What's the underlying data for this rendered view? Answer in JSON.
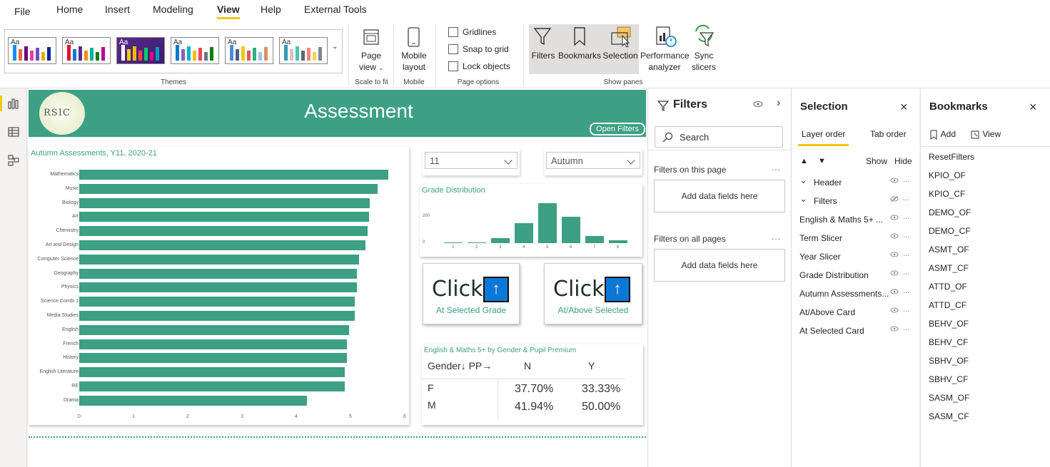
{
  "menu": {
    "items": [
      "File",
      "Home",
      "Insert",
      "Modeling",
      "View",
      "Help",
      "External Tools"
    ],
    "active": "View"
  },
  "ribbon": {
    "themes_label": "Themes",
    "theme_prefix": "Aa",
    "scale_to_fit": {
      "label_line1": "Page",
      "label_line2": "view",
      "group": "Scale to fit"
    },
    "mobile": {
      "label_line1": "Mobile",
      "label_line2": "layout",
      "group": "Mobile"
    },
    "page_options": {
      "gridlines": "Gridlines",
      "snap": "Snap to grid",
      "lock": "Lock objects",
      "group": "Page options"
    },
    "show_panes": {
      "filters": "Filters",
      "bookmarks": "Bookmarks",
      "selection": "Selection",
      "perf_line1": "Performance",
      "perf_line2": "analyzer",
      "sync_line1": "Sync",
      "sync_line2": "slicers",
      "group": "Show panes"
    }
  },
  "report": {
    "title": "Assessment",
    "logo_text": "RSIC",
    "open_filters": "Open Filters",
    "year_slicer": "11",
    "term_slicer": "Autumn",
    "click_label": "Click",
    "arrow_glyph": "↑",
    "card1_sub": "At Selected Grade",
    "card2_sub": "At/Above Selected",
    "matrix": {
      "title": "English & Maths 5+ by Gender & Pupil Premium",
      "header": "Gender↓ PP→",
      "cols": [
        "N",
        "Y"
      ],
      "rows": [
        {
          "label": "F",
          "N": "37.70%",
          "Y": "33.33%"
        },
        {
          "label": "M",
          "N": "41.94%",
          "Y": "50.00%"
        }
      ]
    }
  },
  "chart_data": [
    {
      "type": "bar",
      "orientation": "horizontal",
      "title": "Autumn Assessments, Y11, 2020-21",
      "categories": [
        "Mathematics",
        "Music",
        "Biology",
        "Art",
        "Chemistry",
        "Art and Design",
        "Computer Science",
        "Geography",
        "Physics",
        "Science Combi 1",
        "Media Studies",
        "English",
        "French",
        "History",
        "English Literature",
        "RE",
        "Drama"
      ],
      "values": [
        5.7,
        5.5,
        5.35,
        5.34,
        5.32,
        5.28,
        5.16,
        5.12,
        5.12,
        5.08,
        5.08,
        4.97,
        4.93,
        4.93,
        4.9,
        4.89,
        4.2
      ],
      "xlim": [
        0,
        6
      ],
      "xticks": [
        "0",
        "1",
        "2",
        "3",
        "4",
        "5",
        "6"
      ]
    },
    {
      "type": "bar",
      "title": "Grade Distribution",
      "categories": [
        "1",
        "2",
        "3",
        "4",
        "5",
        "6",
        "7",
        "8"
      ],
      "values": [
        3,
        4,
        40,
        150,
        300,
        195,
        55,
        20
      ],
      "ylim": [
        0,
        320
      ],
      "yticks": [
        "0",
        "200"
      ]
    }
  ],
  "filters_pane": {
    "title": "Filters",
    "search_placeholder": "Search",
    "on_this_page": "Filters on this page",
    "on_all_pages": "Filters on all pages",
    "add_fields": "Add data fields here",
    "dots": "..."
  },
  "selection_pane": {
    "title": "Selection",
    "tab_layer": "Layer order",
    "tab_tab": "Tab order",
    "show": "Show",
    "hide": "Hide",
    "items": [
      {
        "label": "Header",
        "group": true
      },
      {
        "label": "Filters",
        "group": true
      },
      {
        "label": "English & Maths 5+ ...",
        "group": false
      },
      {
        "label": "Term Slicer",
        "group": false
      },
      {
        "label": "Year Slicer",
        "group": false
      },
      {
        "label": "Grade Distribution",
        "group": false
      },
      {
        "label": "Autumn Assessments...",
        "group": false
      },
      {
        "label": "At/Above Card",
        "group": false
      },
      {
        "label": "At Selected Card",
        "group": false
      }
    ]
  },
  "bookmarks_pane": {
    "title": "Bookmarks",
    "add": "Add",
    "view": "View",
    "items": [
      "ResetFilters",
      "KPIO_OF",
      "KPIO_CF",
      "DEMO_OF",
      "DEMO_CF",
      "ASMT_OF",
      "ASMT_CF",
      "ATTD_OF",
      "ATTD_CF",
      "BEHV_OF",
      "BEHV_CF",
      "SBHV_OF",
      "SBHV_CF",
      "SASM_OF",
      "SASM_CF"
    ]
  },
  "colors": {
    "accent": "#3d9f83",
    "highlight": "#f2c811",
    "card_arrow": "#0a78d6"
  },
  "icons": {
    "close": "×",
    "chevron": "›"
  }
}
